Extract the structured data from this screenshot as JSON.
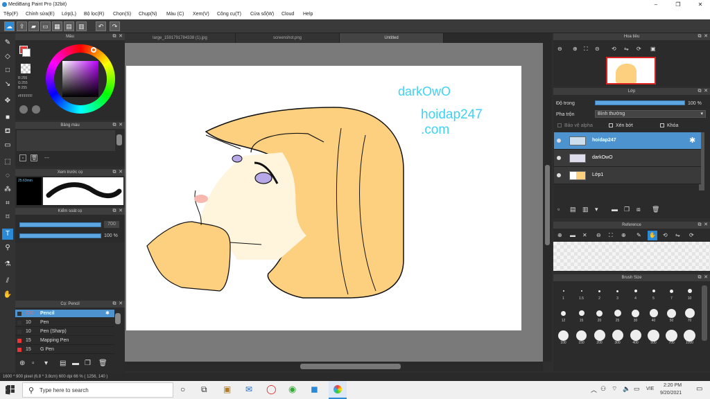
{
  "window": {
    "title": "MediBang Paint Pro (32bit)",
    "minimize": "–",
    "maximize": "❐",
    "close": "✕"
  },
  "menu": [
    "Tệp(F)",
    "Chỉnh sửa(E)",
    "Lớp(L)",
    "Bộ lọc(R)",
    "Chọn(S)",
    "Chụp(N)",
    "Màu (C)",
    "Xem(V)",
    "Công cụ(T)",
    "Cửa sổ(W)",
    "Cloud",
    "Help"
  ],
  "tabs": [
    "large_1591791784338 (1).jpg",
    "screenshot.png",
    "Untitled"
  ],
  "panels": {
    "color": {
      "title": "Màu",
      "rgb": [
        "R:255",
        "G:255",
        "B:255"
      ],
      "hex": "#FFFFFF"
    },
    "palette": {
      "title": "Bảng màu",
      "footer": "---"
    },
    "preview": {
      "title": "Xem trước cọ",
      "size": "25.63mm"
    },
    "control": {
      "title": "Kiểm soát cọ",
      "size_val": "700",
      "opacity_val": "100 %"
    },
    "brush": {
      "title": "Cọ: Pencil",
      "items": [
        {
          "size": "700",
          "name": "Pencil"
        },
        {
          "size": "10",
          "name": "Pen"
        },
        {
          "size": "10",
          "name": "Pen (Sharp)"
        },
        {
          "size": "15",
          "name": "Mapping Pen"
        },
        {
          "size": "15",
          "name": "G Pen"
        }
      ]
    },
    "navigator": {
      "title": "Hoa tiêu"
    },
    "layers": {
      "title": "Lớp",
      "opacity_label": "Độ trong",
      "opacity_val": "100 %",
      "blend_label": "Pha trộn",
      "blend_val": "Bình thường",
      "protect_alpha": "Bảo vệ alpha",
      "clip": "Xén bớt",
      "lock": "Khóa",
      "items": [
        {
          "name": "hoidap247",
          "selected": true
        },
        {
          "name": "darkOwO",
          "selected": false
        },
        {
          "name": "Lớp1",
          "selected": false
        }
      ]
    },
    "reference": {
      "title": "Reference"
    },
    "brushsize": {
      "title": "Brush Size",
      "row1": [
        "1",
        "1.5",
        "2",
        "3",
        "4",
        "5",
        "7",
        "10"
      ],
      "row2": [
        "12",
        "15",
        "20",
        "25",
        "30",
        "40",
        "50",
        "70"
      ],
      "row3": [
        "100",
        "150",
        "200",
        "300",
        "400",
        "500",
        "700",
        "1000"
      ]
    }
  },
  "canvas_text": {
    "t1": "darkOwO",
    "t2": "hoidap247",
    "t3": ".com"
  },
  "status": "1600 * 900 pixel   (6.8 * 3.8cm)   600 dpi   66 %   ( 1256, 140 )",
  "taskbar": {
    "search": "Type here to search",
    "lang": "VIE",
    "time": "2:20 PM",
    "date": "9/20/2021"
  }
}
